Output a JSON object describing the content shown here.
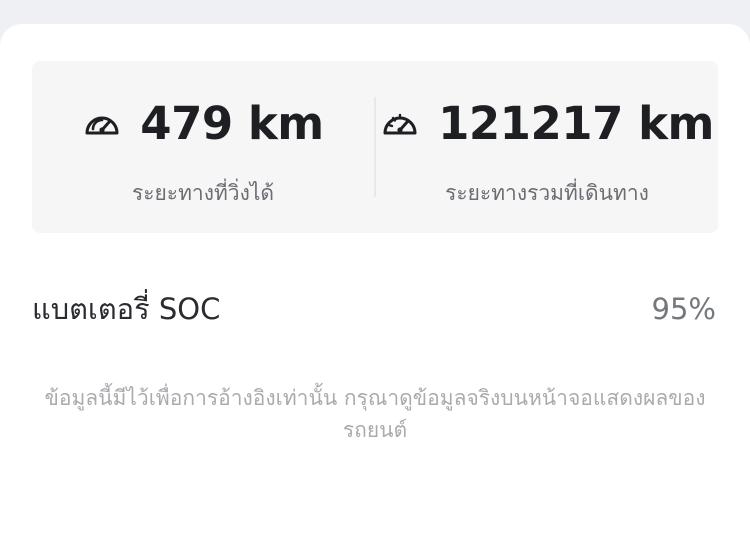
{
  "stats": [
    {
      "icon": "speedometer-icon",
      "value": "479 km",
      "label": "ระยะทางที่วิ่งได้"
    },
    {
      "icon": "odometer-icon",
      "value": "121217 km",
      "label": "ระยะทางรวมที่เดินทาง"
    }
  ],
  "battery": {
    "label": "แบตเตอรี่ SOC",
    "value": "95%"
  },
  "disclaimer": "ข้อมูลนี้มีไว้เพื่อการอ้างอิงเท่านั้น กรุณาดูข้อมูลจริงบนหน้าจอแสดงผลของรถยนต์"
}
